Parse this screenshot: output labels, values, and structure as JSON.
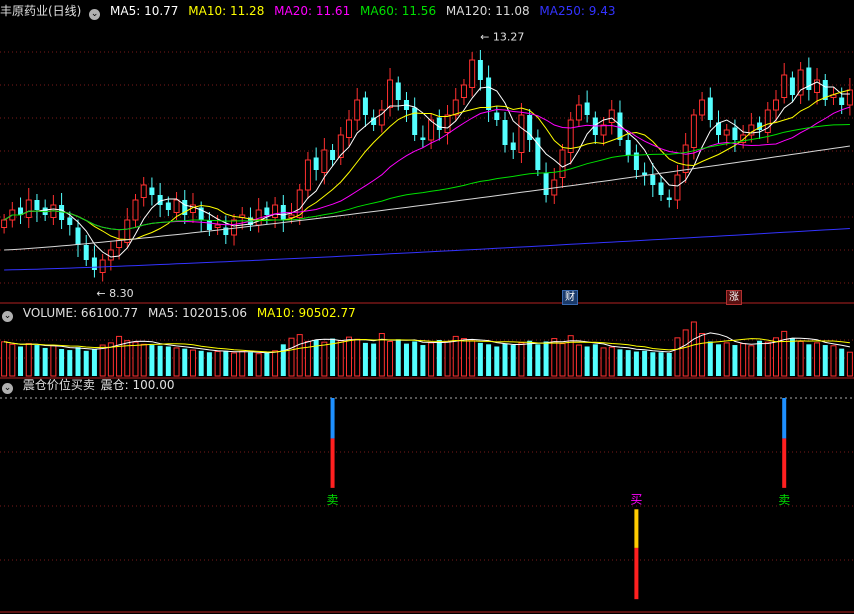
{
  "main": {
    "title": "丰原药业(日线)",
    "ma": [
      {
        "label": "MA5: 10.77",
        "color": "#ffffff"
      },
      {
        "label": "MA10: 11.28",
        "color": "#ffff00"
      },
      {
        "label": "MA20: 11.61",
        "color": "#ff00ff"
      },
      {
        "label": "MA60: 11.56",
        "color": "#00e000"
      },
      {
        "label": "MA120: 11.08",
        "color": "#d8d8d8"
      },
      {
        "label": "MA250: 9.43",
        "color": "#3333ff"
      }
    ],
    "high_label": "13.27",
    "low_label": "8.30",
    "badge_fin": "财",
    "badge_up": "涨"
  },
  "volume": {
    "label": "VOLUME: 66100.77",
    "ma5": "MA5: 102015.06",
    "ma10": "MA10: 90502.77"
  },
  "indicator": {
    "name": "震仓价位买卖",
    "value_label": "震仓: 100.00",
    "signals": [
      {
        "text": "卖",
        "color": "#00e000"
      },
      {
        "text": "买",
        "color": "#ff00ff"
      },
      {
        "text": "卖",
        "color": "#00e000"
      }
    ]
  },
  "colors": {
    "up": "#ff3030",
    "down": "#54ffff",
    "grid": "#7a1a1a",
    "border": "#b22222"
  },
  "chart_data": [
    {
      "type": "candlestick",
      "title": "丰原药业(日线)",
      "y_range": [
        8.0,
        13.6
      ],
      "price_high": 13.27,
      "price_low": 8.3,
      "ma_latest": {
        "MA5": 10.77,
        "MA10": 11.28,
        "MA20": 11.61,
        "MA60": 11.56,
        "MA120": 11.08,
        "MA250": 9.43
      },
      "closes": [
        9.6,
        9.8,
        9.7,
        10.0,
        9.8,
        9.7,
        9.9,
        9.6,
        9.5,
        9.1,
        8.8,
        8.6,
        8.8,
        9.0,
        9.2,
        9.6,
        10.0,
        10.3,
        10.1,
        9.9,
        9.8,
        10.0,
        9.7,
        9.9,
        9.6,
        9.4,
        9.5,
        9.3,
        9.6,
        9.7,
        9.5,
        9.8,
        9.7,
        9.9,
        9.6,
        9.7,
        10.2,
        10.8,
        10.6,
        11.0,
        10.8,
        11.3,
        11.6,
        12.0,
        11.7,
        11.5,
        11.8,
        12.4,
        12.0,
        11.8,
        11.3,
        11.2,
        11.6,
        11.4,
        11.7,
        12.0,
        12.3,
        12.8,
        12.4,
        11.8,
        11.6,
        11.1,
        11.0,
        11.7,
        11.2,
        10.6,
        10.1,
        10.4,
        11.0,
        11.6,
        11.9,
        11.7,
        11.3,
        11.5,
        11.8,
        11.2,
        10.9,
        10.6,
        10.5,
        10.3,
        10.1,
        10.0,
        10.5,
        11.1,
        11.7,
        12.0,
        11.6,
        11.3,
        11.4,
        11.2,
        11.3,
        11.5,
        11.4,
        11.8,
        12.0,
        12.5,
        12.1,
        12.6,
        12.2,
        12.4,
        12.0,
        12.1,
        11.9,
        12.2
      ],
      "volumes": [
        95000,
        88000,
        82000,
        90000,
        86000,
        78000,
        84000,
        75000,
        72000,
        80000,
        70000,
        74000,
        86000,
        92000,
        110000,
        98000,
        94000,
        88000,
        86000,
        84000,
        82000,
        78000,
        76000,
        72000,
        70000,
        66000,
        68000,
        70000,
        64000,
        68000,
        66000,
        62000,
        64000,
        70000,
        88000,
        105000,
        115000,
        96000,
        100000,
        94000,
        104000,
        98000,
        108000,
        102000,
        92000,
        90000,
        118000,
        96000,
        102000,
        90000,
        96000,
        86000,
        92000,
        100000,
        96000,
        110000,
        104000,
        98000,
        92000,
        88000,
        82000,
        90000,
        86000,
        92000,
        98000,
        88000,
        96000,
        104000,
        90000,
        112000,
        86000,
        82000,
        88000,
        78000,
        80000,
        74000,
        72000,
        68000,
        70000,
        66000,
        66000,
        64000,
        106000,
        128000,
        150000,
        118000,
        96000,
        88000,
        92000,
        86000,
        90000,
        84000,
        98000,
        94000,
        106000,
        124000,
        104000,
        96000,
        88000,
        92000,
        86000,
        84000,
        76000,
        66100
      ],
      "volume_ma_latest": {
        "MA5": 102015.06,
        "MA10": 90502.77
      }
    },
    {
      "type": "bar",
      "title": "震仓价位买卖",
      "value_label": "震仓: 100.00",
      "signals": [
        {
          "bar_index": 40,
          "kind": "sell",
          "value": 100,
          "segments": [
            {
              "color": "#1e90ff",
              "share": 0.45
            },
            {
              "color": "#ff2020",
              "share": 0.55
            }
          ]
        },
        {
          "bar_index": 77,
          "kind": "buy",
          "value": 100,
          "segments": [
            {
              "color": "#ffcc00",
              "share": 0.43
            },
            {
              "color": "#ff2020",
              "share": 0.57
            }
          ]
        },
        {
          "bar_index": 95,
          "kind": "sell",
          "value": 100,
          "segments": [
            {
              "color": "#1e90ff",
              "share": 0.45
            },
            {
              "color": "#ff2020",
              "share": 0.55
            }
          ]
        }
      ]
    }
  ]
}
